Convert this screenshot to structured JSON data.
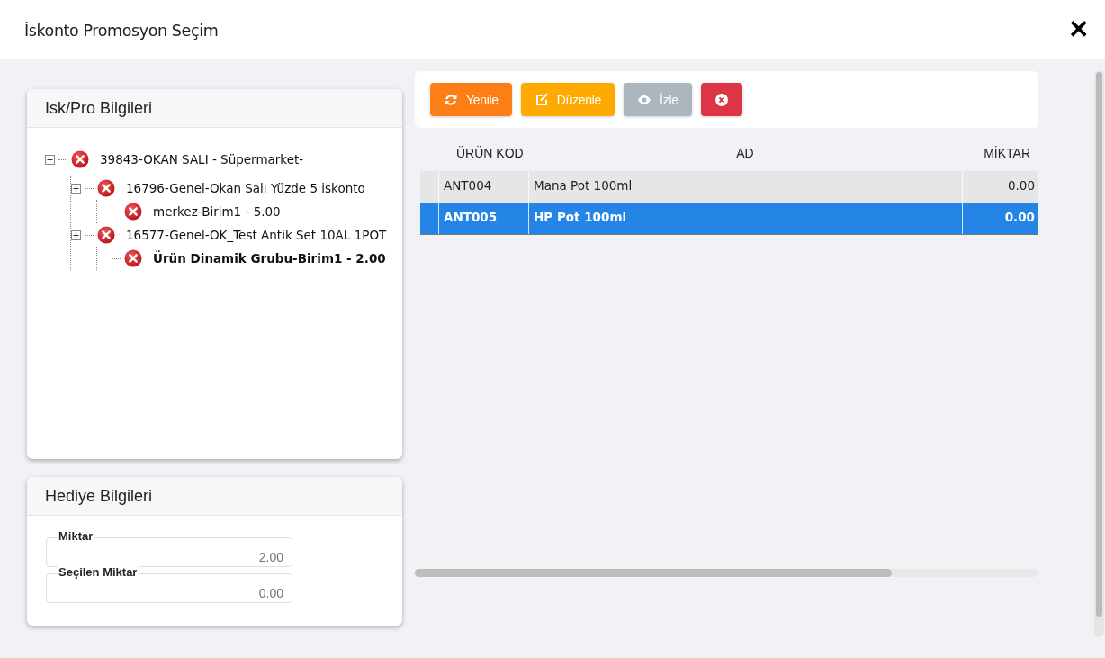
{
  "window": {
    "title": "İskonto Promosyon Seçim",
    "close": "✕"
  },
  "discount_panel": {
    "title": "Isk/Pro Bilgileri",
    "tree": [
      {
        "label": "39843-OKAN SALI - Süpermarket-",
        "expanded": true,
        "selected": false,
        "children": [
          {
            "label": "16796-Genel-Okan Salı Yüzde 5 iskonto",
            "expanded": false,
            "selected": false,
            "children": [
              {
                "label": "merkez-Birim1 - 5.00",
                "selected": false
              }
            ]
          },
          {
            "label": "16577-Genel-OK_Test Antik Set 10AL 1POT",
            "expanded": false,
            "selected": false,
            "children": [
              {
                "label": "Ürün Dinamik Grubu-Birim1 - 2.00",
                "selected": true
              }
            ]
          }
        ]
      }
    ]
  },
  "gift_panel": {
    "title": "Hediye Bilgileri",
    "fields": [
      {
        "label": "Miktar",
        "value": "2.00"
      },
      {
        "label": "Seçilen Miktar",
        "value": "0.00"
      }
    ]
  },
  "toolbar": [
    {
      "kind": "refresh",
      "label": "Yenile"
    },
    {
      "kind": "edit",
      "label": "Düzenle"
    },
    {
      "kind": "view",
      "label": "İzle"
    },
    {
      "kind": "cancel"
    }
  ],
  "table": {
    "columns": [
      "ÜRÜN KOD",
      "AD",
      "MİKTAR"
    ],
    "rows": [
      {
        "cells": [
          "ANT004",
          "Mana Pot 100ml",
          "0.00"
        ],
        "selected": false
      },
      {
        "cells": [
          "ANT005",
          "HP Pot 100ml",
          "0.00"
        ],
        "selected": true
      }
    ]
  }
}
